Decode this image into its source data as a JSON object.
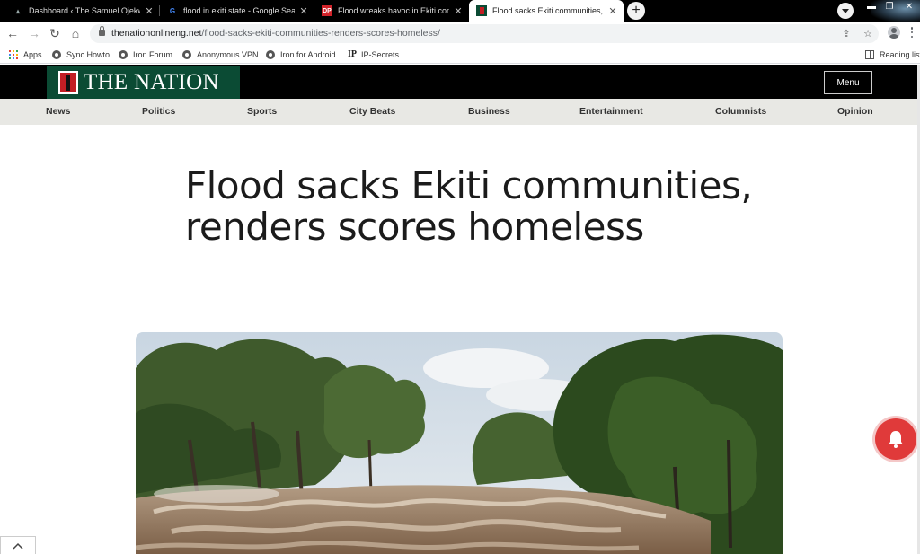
{
  "browser": {
    "tabs": [
      {
        "title": "Dashboard ‹ The Samuel Ojekwe",
        "favicon": "wordpress-favicon"
      },
      {
        "title": "flood in ekiti state - Google Search",
        "favicon": "google-favicon"
      },
      {
        "title": "Flood wreaks havoc in Ekiti comm",
        "favicon": "dailypost-favicon"
      },
      {
        "title": "Flood sacks Ekiti communities, re",
        "favicon": "nation-favicon",
        "active": true
      }
    ],
    "url": {
      "domain": "thenationonlineng.net",
      "path": "/flood-sacks-ekiti-communities-renders-scores-homeless/"
    },
    "bookmarks": [
      {
        "label": "Apps",
        "icon": "apps-grid-icon"
      },
      {
        "label": "Sync Howto",
        "icon": "globe-icon"
      },
      {
        "label": "Iron Forum",
        "icon": "globe-icon"
      },
      {
        "label": "Anonymous VPN",
        "icon": "globe-icon"
      },
      {
        "label": "Iron for Android",
        "icon": "globe-icon"
      },
      {
        "label": "IP-Secrets",
        "icon": "ip-icon"
      }
    ],
    "reading_list": "Reading list"
  },
  "site": {
    "logo_text": "THE NATION",
    "menu_label": "Menu",
    "nav": [
      "News",
      "Politics",
      "Sports",
      "City Beats",
      "Business",
      "Entertainment",
      "Columnists",
      "Opinion"
    ]
  },
  "article": {
    "headline": "Flood sacks Ekiti communities, renders scores homeless"
  },
  "colors": {
    "logo_green": "#0b4b34",
    "logo_red": "#c21e24",
    "notification_red": "#e03a3a",
    "nav_bg": "#e8e8e4"
  }
}
